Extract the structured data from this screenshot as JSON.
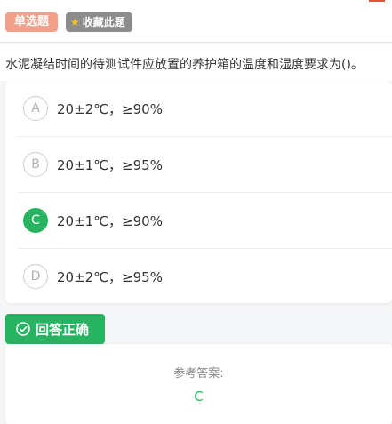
{
  "tags": {
    "question_type": "单选题",
    "favorite_label": "收藏此题",
    "favorite_icon": "star-icon"
  },
  "question": {
    "text": "水泥凝结时间的待测试件应放置的养护箱的温度和湿度要求为()。"
  },
  "options": [
    {
      "letter": "A",
      "text": "20±2℃，≥90%",
      "selected": false
    },
    {
      "letter": "B",
      "text": "20±1℃，≥95%",
      "selected": false
    },
    {
      "letter": "C",
      "text": "20±1℃，≥90%",
      "selected": true
    },
    {
      "letter": "D",
      "text": "20±2℃，≥95%",
      "selected": false
    }
  ],
  "result": {
    "label": "回答正确",
    "icon": "check-circle-icon"
  },
  "answer": {
    "label": "参考答案:",
    "value": "C"
  },
  "colors": {
    "correct_green": "#27b361",
    "tag_salmon": "#f3a08a",
    "tag_gray": "#8c8c8c",
    "star_yellow": "#f7c325"
  }
}
